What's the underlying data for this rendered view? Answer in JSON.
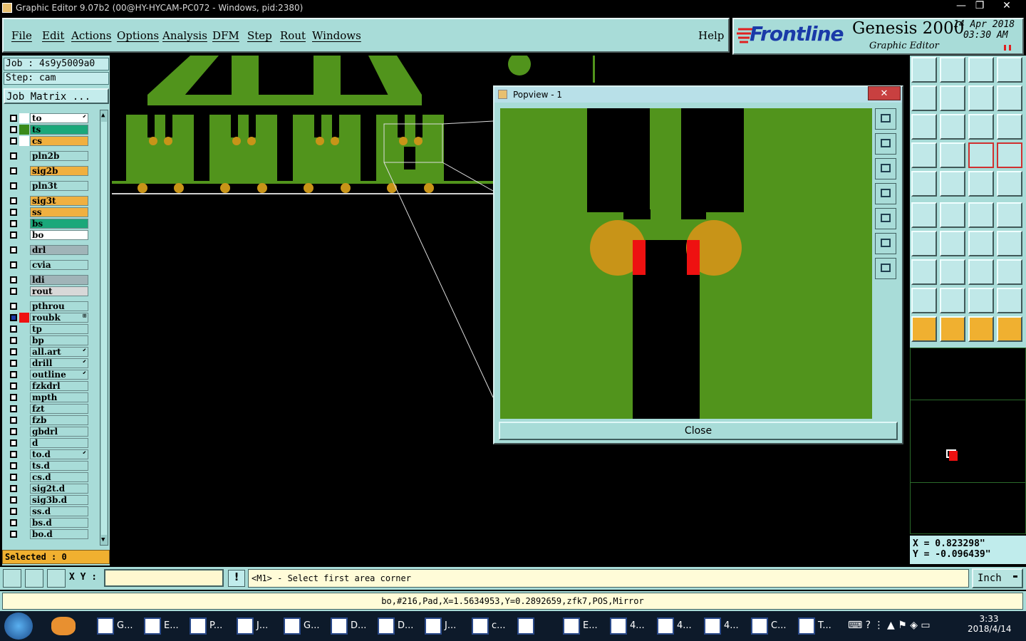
{
  "window": {
    "title": "Graphic Editor 9.07b2 (00@HY-HYCAM-PC072 - Windows, pid:2380)",
    "min": "—",
    "max": "❐",
    "close": "✕"
  },
  "menu": [
    "File",
    "Edit",
    "Actions",
    "Options",
    "Analysis",
    "DFM",
    "Step",
    "Rout",
    "Windows"
  ],
  "help": "Help",
  "brand": {
    "logo": "Frontline",
    "product": "Genesis 2000",
    "subtitle": "Graphic Editor",
    "date": "14 Apr 2018",
    "time": "03:30 AM"
  },
  "job": {
    "job": "Job : 4s9y5009a0",
    "step": "Step: cam",
    "matrix": "Job Matrix ..."
  },
  "layers": [
    {
      "name": "to",
      "bg": "#ffffff",
      "sw": "#ffffff",
      "mark": "⬋"
    },
    {
      "name": "ts",
      "bg": "#1aa87a",
      "sw": "#3a8a1a",
      "mark": ""
    },
    {
      "name": "cs",
      "bg": "#f0b040",
      "sw": "#ffffff",
      "mark": ""
    },
    {
      "name": "pln2b",
      "bg": "#a8dcd8",
      "sw": "#a8dcd8",
      "mark": ""
    },
    {
      "name": "sig2b",
      "bg": "#f0b040",
      "sw": "#a8dcd8",
      "mark": ""
    },
    {
      "name": "pln3t",
      "bg": "#a8dcd8",
      "sw": "#a8dcd8",
      "mark": ""
    },
    {
      "name": "sig3t",
      "bg": "#f0b040",
      "sw": "#a8dcd8",
      "mark": ""
    },
    {
      "name": "ss",
      "bg": "#f0b040",
      "sw": "#a8dcd8",
      "mark": ""
    },
    {
      "name": "bs",
      "bg": "#1aa87a",
      "sw": "#a8dcd8",
      "mark": ""
    },
    {
      "name": "bo",
      "bg": "#ffffff",
      "sw": "#a8dcd8",
      "mark": ""
    },
    {
      "name": "drl",
      "bg": "#a0b4b8",
      "sw": "#a8dcd8",
      "mark": ""
    },
    {
      "name": "cvia",
      "bg": "#a8dcd8",
      "sw": "#a8dcd8",
      "mark": ""
    },
    {
      "name": "ldi",
      "bg": "#a0b4b8",
      "sw": "#a8dcd8",
      "mark": ""
    },
    {
      "name": "rout",
      "bg": "#d8d8d8",
      "sw": "#a8dcd8",
      "mark": ""
    },
    {
      "name": "pthrou",
      "bg": "#a8dcd8",
      "sw": "#a8dcd8",
      "mark": ""
    },
    {
      "name": "roubk",
      "bg": "#a8dcd8",
      "sw": "#ee1111",
      "mark": "⊞"
    },
    {
      "name": "tp",
      "bg": "#a8dcd8",
      "sw": "#a8dcd8",
      "mark": ""
    },
    {
      "name": "bp",
      "bg": "#a8dcd8",
      "sw": "#a8dcd8",
      "mark": ""
    },
    {
      "name": "all.art",
      "bg": "#a8dcd8",
      "sw": "#a8dcd8",
      "mark": "⬋"
    },
    {
      "name": "drill",
      "bg": "#a8dcd8",
      "sw": "#a8dcd8",
      "mark": "⬋"
    },
    {
      "name": "outline",
      "bg": "#a8dcd8",
      "sw": "#a8dcd8",
      "mark": "⬋"
    },
    {
      "name": "fzkdrl",
      "bg": "#a8dcd8",
      "sw": "#a8dcd8",
      "mark": ""
    },
    {
      "name": "mpth",
      "bg": "#a8dcd8",
      "sw": "#a8dcd8",
      "mark": ""
    },
    {
      "name": "fzt",
      "bg": "#a8dcd8",
      "sw": "#a8dcd8",
      "mark": ""
    },
    {
      "name": "fzb",
      "bg": "#a8dcd8",
      "sw": "#a8dcd8",
      "mark": ""
    },
    {
      "name": "gbdrl",
      "bg": "#a8dcd8",
      "sw": "#a8dcd8",
      "mark": ""
    },
    {
      "name": "d",
      "bg": "#a8dcd8",
      "sw": "#a8dcd8",
      "mark": ""
    },
    {
      "name": "to.d",
      "bg": "#a8dcd8",
      "sw": "#a8dcd8",
      "mark": "⬋"
    },
    {
      "name": "ts.d",
      "bg": "#a8dcd8",
      "sw": "#a8dcd8",
      "mark": ""
    },
    {
      "name": "cs.d",
      "bg": "#a8dcd8",
      "sw": "#a8dcd8",
      "mark": ""
    },
    {
      "name": "sig2t.d",
      "bg": "#a8dcd8",
      "sw": "#a8dcd8",
      "mark": ""
    },
    {
      "name": "sig3b.d",
      "bg": "#a8dcd8",
      "sw": "#a8dcd8",
      "mark": ""
    },
    {
      "name": "ss.d",
      "bg": "#a8dcd8",
      "sw": "#a8dcd8",
      "mark": ""
    },
    {
      "name": "bs.d",
      "bg": "#a8dcd8",
      "sw": "#a8dcd8",
      "mark": ""
    },
    {
      "name": "bo.d",
      "bg": "#a8dcd8",
      "sw": "#a8dcd8",
      "mark": ""
    }
  ],
  "selected": "Selected : 0",
  "popview": {
    "title": "Popview - 1",
    "close": "Close"
  },
  "coords": {
    "x": "X = 0.823298\"",
    "y": "Y = -0.096439\""
  },
  "cmd": {
    "xy_label": "X Y :",
    "xy_value": "",
    "prompt": "<M1> - Select first area corner",
    "units": "Inch"
  },
  "status": "bo,#216,Pad,X=1.5634953,Y=0.2892659,zfk7,POS,Mirror",
  "taskbar": {
    "items": [
      "G...",
      "E...",
      "P...",
      "J...",
      "G...",
      "D...",
      "D...",
      "J...",
      "c...",
      "",
      "E...",
      "4...",
      "4...",
      "4...",
      "C...",
      "T..."
    ],
    "clock_time": "3:33",
    "clock_date": "2018/4/14"
  },
  "colors": {
    "panel": "#a8dcd8",
    "copper": "#51941c",
    "pad": "#c89418",
    "highlight": "#ee1111"
  }
}
